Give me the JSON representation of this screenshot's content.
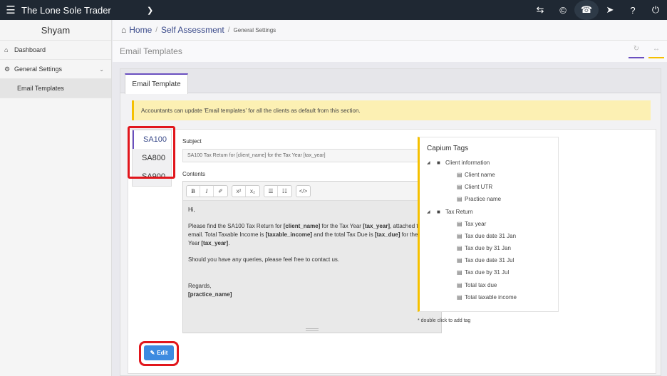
{
  "topbar": {
    "brand": "The Lone Sole Trader",
    "icons": [
      "menu-icon",
      "chevron-down-icon",
      "transfer-icon",
      "capium-icon",
      "megaphone-icon",
      "rocket-icon",
      "question-icon",
      "power-icon"
    ]
  },
  "sidebar": {
    "user": "Shyam",
    "items": [
      {
        "label": "Dashboard",
        "icon": "home-icon"
      },
      {
        "label": "General Settings",
        "icon": "gears-icon"
      },
      {
        "label": "Email Templates",
        "icon": "dot-icon"
      }
    ]
  },
  "breadcrumb": {
    "home": "Home",
    "sep": "/",
    "self_assessment": "Self Assessment",
    "current": "General Settings"
  },
  "page_title": "Email Templates",
  "tab": {
    "label": "Email Template"
  },
  "notice": "Accountants can update 'Email templates' for all the clients as default from this section.",
  "vtabs": [
    "SA100",
    "SA800",
    "SA900"
  ],
  "form": {
    "subject_label": "Subject",
    "subject_value": "SA100 Tax Return for [client_name] for the Tax Year [tax_year]",
    "contents_label": "Contents",
    "toolbar": {
      "bold": "B",
      "italic": "I",
      "eraser": "✐",
      "superscript": "x²",
      "subscript": "x₂",
      "ul": "☰",
      "ol": "☷",
      "code": "</>",
      "undo": "↺"
    },
    "body": {
      "greeting": "Hi,",
      "p1_a": "Please find the SA100 Tax Return for ",
      "p1_b": "[client_name]",
      "p1_c": " for the Tax Year ",
      "p1_d": "[tax_year]",
      "p1_e": ", attached to this email. Total Taxable Income is ",
      "p1_f": "[taxable_income]",
      "p1_g": " and the total Tax Due is ",
      "p1_h": "[tax_due]",
      "p1_i": " for the Tax Year ",
      "p1_j": "[tax_year]",
      "p1_k": ".",
      "p2": "Should you have any queries, please feel free to contact us.",
      "regards": "Regards,",
      "signature": "[practice_name]"
    },
    "edit_label": "Edit"
  },
  "tags": {
    "title": "Capium Tags",
    "client_folder": "Client information",
    "client_items": [
      "Client name",
      "Client UTR",
      "Practice name"
    ],
    "tax_folder": "Tax Return",
    "tax_items": [
      "Tax year",
      "Tax due date 31 Jan",
      "Tax due by 31 Jan",
      "Tax due date 31 Jul",
      "Tax due by 31 Jul",
      "Total tax due",
      "Total taxable income"
    ],
    "note": "* double click to add tag"
  },
  "colors": {
    "topbar": "#1f2833",
    "accent": "#6a4fc0",
    "highlight": "#e1161c",
    "edit_button": "#3d8be0",
    "notice": "#fcf0b3"
  }
}
